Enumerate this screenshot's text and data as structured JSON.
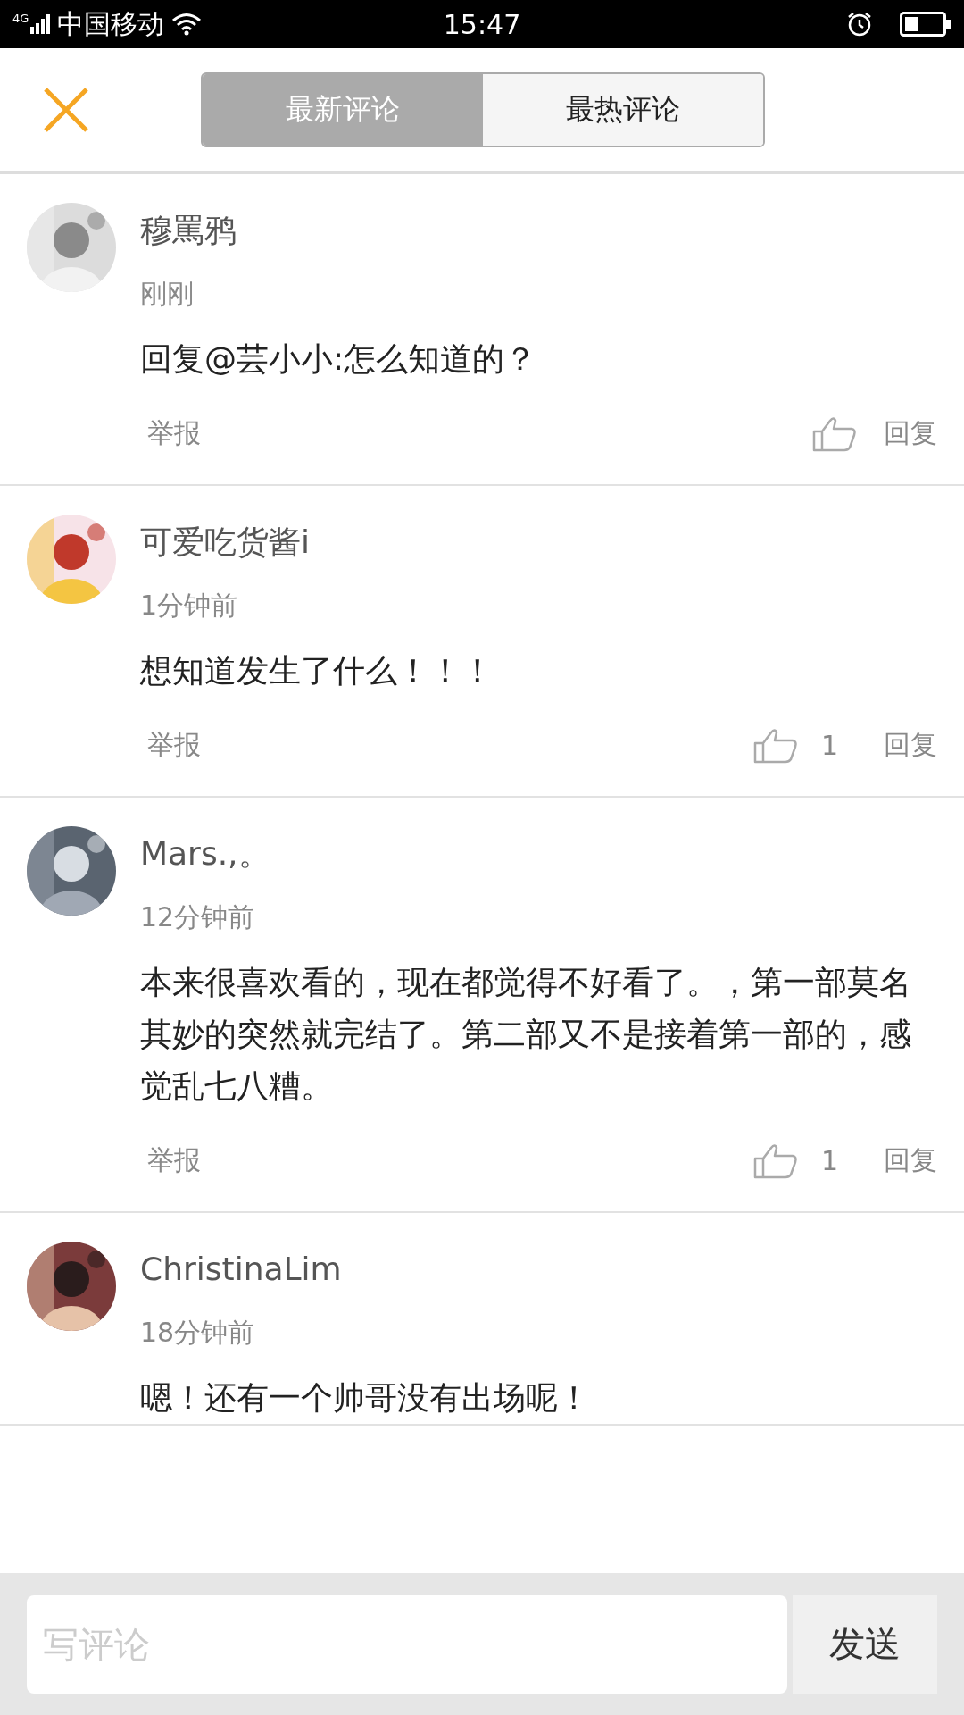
{
  "status_bar": {
    "network": "4G",
    "carrier": "中国移动",
    "time": "15:47"
  },
  "tabs": [
    {
      "label": "最新评论",
      "selected": true
    },
    {
      "label": "最热评论",
      "selected": false
    }
  ],
  "comments": [
    {
      "name": "穆罵鸦",
      "time": "刚刚",
      "text": "回复@芸小小:怎么知道的？",
      "actions": {
        "report": "举报",
        "reply": "回复"
      }
    },
    {
      "name": "可爱吃货酱i",
      "time": "1分钟前",
      "text": "想知道发生了什么！！！",
      "actions": {
        "report": "举报",
        "likes": "1",
        "reply": "回复"
      }
    },
    {
      "name": "Mars.,。",
      "time": "12分钟前",
      "text": "本来很喜欢看的，现在都觉得不好看了。，第一部莫名其妙的突然就完结了。第二部又不是接着第一部的，感觉乱七八糟。",
      "actions": {
        "report": "举报",
        "likes": "1",
        "reply": "回复"
      }
    },
    {
      "name": "ChristinaLim",
      "time": "18分钟前",
      "text": "嗯！还有一个帅哥没有出场呢！"
    }
  ],
  "composer": {
    "placeholder": "写评论",
    "send": "发送"
  }
}
